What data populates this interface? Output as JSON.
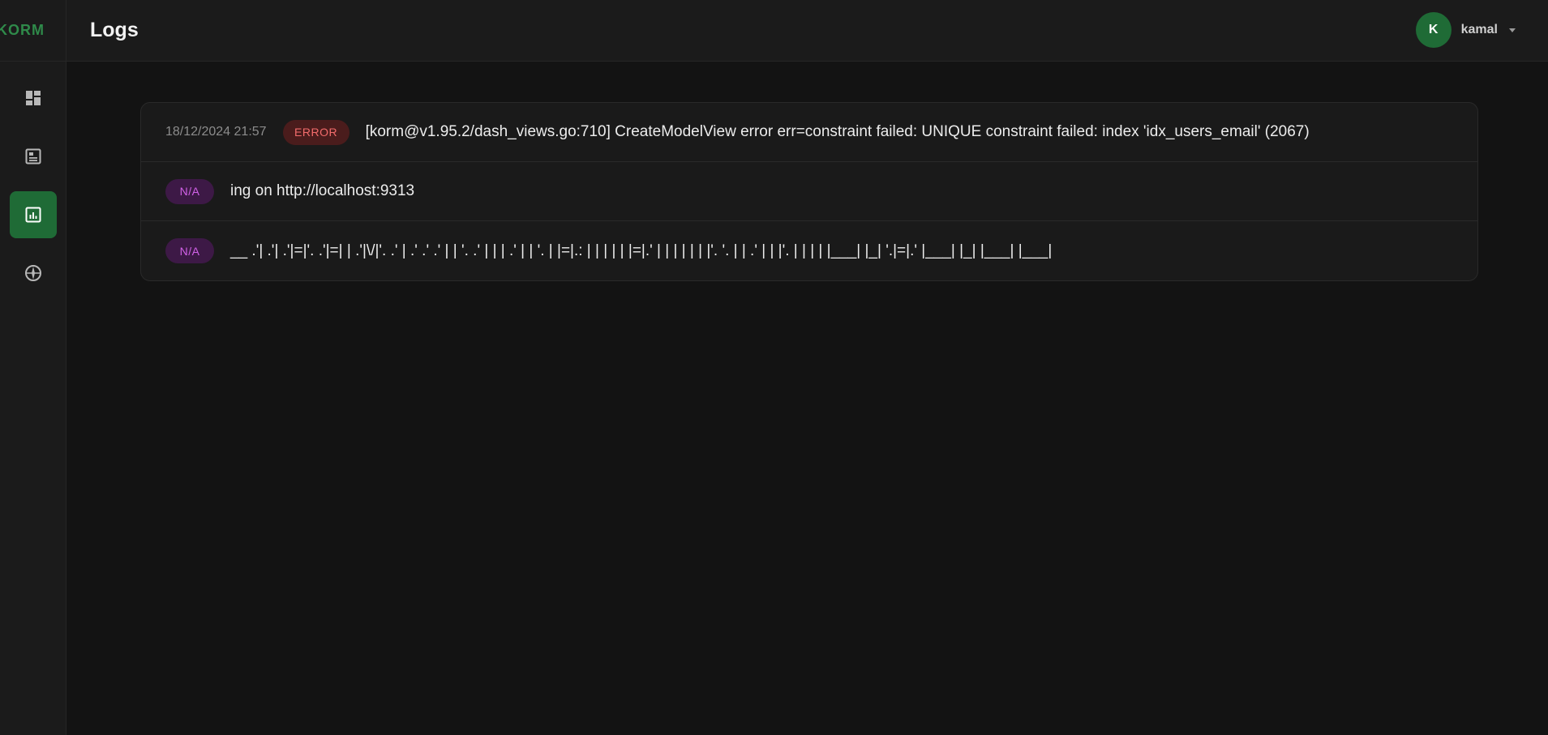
{
  "app": {
    "brand": "KORM"
  },
  "header": {
    "title": "Logs"
  },
  "user": {
    "initial": "K",
    "name": "kamal"
  },
  "nav": [
    {
      "icon": "dashboard-icon",
      "active": false
    },
    {
      "icon": "tables-icon",
      "active": false
    },
    {
      "icon": "logs-icon",
      "active": true
    },
    {
      "icon": "compass-icon",
      "active": false
    }
  ],
  "logs": [
    {
      "time": "18/12/2024 21:57",
      "level": "ERROR",
      "message": "[korm@v1.95.2/dash_views.go:710] CreateModelView error err=constraint failed: UNIQUE constraint failed: index 'idx_users_email' (2067)"
    },
    {
      "time": "",
      "level": "N/A",
      "message": "ing on http://localhost:9313"
    },
    {
      "time": "",
      "level": "N/A",
      "message": "__ .'| .'| .'|=|'. .'|=| | .'|\\/|'. .' | .' .' .' | | '. .' | | | .' | | '. | |=|.: | | | | | |=|.' | | | | | | |'. '. | | .' | | |'. | | | | |___| |_| '.|=|.' |___| |_| |___| |___|"
    }
  ],
  "colors": {
    "accent": "#1f6b36",
    "error_badge_bg": "#4a1c1c",
    "error_badge_fg": "#f26b6b",
    "na_badge_bg": "#3d1946",
    "na_badge_fg": "#d061e6"
  }
}
